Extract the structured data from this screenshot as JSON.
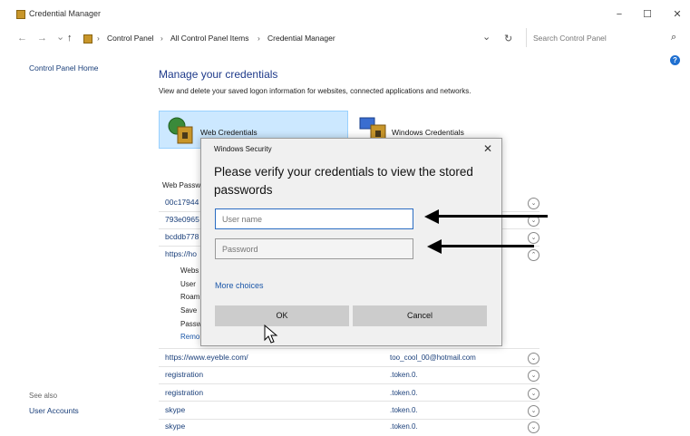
{
  "window": {
    "title": "Credential Manager",
    "minimize": "−",
    "maximize": "☐",
    "close": "✕"
  },
  "address": {
    "back": "←",
    "forward": "→",
    "recent": "⌄",
    "up": "↑",
    "crumbs": [
      "Control Panel",
      "All Control Panel Items",
      "Credential Manager"
    ],
    "separator": "›",
    "dropdown": "⌄",
    "refresh": "↻",
    "search_placeholder": "Search Control Panel",
    "search_icon": "⌕"
  },
  "left": {
    "home_link": "Control Panel Home",
    "see_also": "See also",
    "user_accounts": "User Accounts"
  },
  "main": {
    "heading": "Manage your credentials",
    "subheading": "View and delete your saved logon information for websites, connected applications and networks.",
    "tab_web": "Web Credentials",
    "tab_windows": "Windows Credentials",
    "section_label": "Web Passw",
    "rows_top": [
      "00c17944",
      "793e0965",
      "bcddb778",
      "https://ho"
    ],
    "detail_labels": [
      "Webs",
      "User",
      "Roam",
      "Save",
      "Passw",
      "Remo"
    ],
    "rows_bottom": [
      {
        "left": "https://www.eyeble.com/",
        "right": "too_cool_00@hotmail.com"
      },
      {
        "left": "registration",
        "right": ".token.0."
      },
      {
        "left": "registration",
        "right": ".token.0."
      },
      {
        "left": "skype",
        "right": ".token.0."
      },
      {
        "left": "skype",
        "right": ".token.0."
      }
    ],
    "chevron_down": "⌄",
    "chevron_up": "⌃"
  },
  "dialog": {
    "title": "Windows Security",
    "close": "✕",
    "heading": "Please verify your credentials to view the stored passwords",
    "username_placeholder": "User name",
    "password_placeholder": "Password",
    "more_choices": "More choices",
    "ok": "OK",
    "cancel": "Cancel"
  },
  "colors": {
    "accent": "#1e3a8a",
    "link": "#1a3f7a",
    "selected_tab": "#cce8ff",
    "focus_border": "#2a6cc2"
  }
}
